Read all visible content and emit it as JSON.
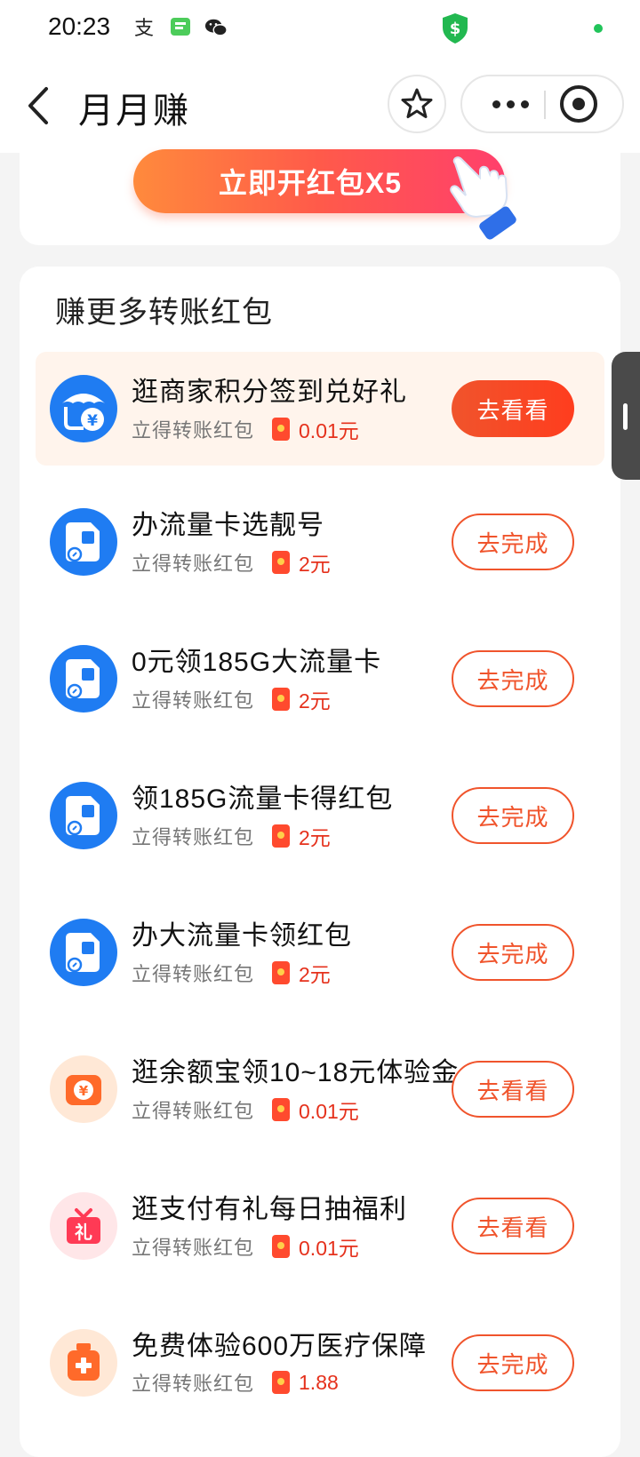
{
  "status_bar": {
    "time": "20:23",
    "icons": [
      "alipay-icon",
      "message-icon",
      "wechat-icon",
      "shield-dollar-icon",
      "online-dot-icon"
    ]
  },
  "nav": {
    "title": "月月赚",
    "icons": [
      "back-arrow-icon",
      "star-icon",
      "more-icon",
      "target-icon"
    ]
  },
  "top_card": {
    "open_button_label": "立即开红包X5"
  },
  "section": {
    "title": "赚更多转账红包",
    "tasks": [
      {
        "title": "逛商家积分签到兑好礼",
        "sub": "立得转账红包",
        "reward": "0.01元",
        "button": "去看看",
        "icon": "merchant-shop-icon",
        "highlight": true
      },
      {
        "title": "办流量卡选靓号",
        "sub": "立得转账红包",
        "reward": "2元",
        "button": "去完成",
        "icon": "sim-card-icon"
      },
      {
        "title": "0元领185G大流量卡",
        "sub": "立得转账红包",
        "reward": "2元",
        "button": "去完成",
        "icon": "sim-card-icon"
      },
      {
        "title": "领185G流量卡得红包",
        "sub": "立得转账红包",
        "reward": "2元",
        "button": "去完成",
        "icon": "sim-card-icon"
      },
      {
        "title": "办大流量卡领红包",
        "sub": "立得转账红包",
        "reward": "2元",
        "button": "去完成",
        "icon": "sim-card-icon"
      },
      {
        "title": "逛余额宝领10~18元体验金",
        "sub": "立得转账红包",
        "reward": "0.01元",
        "button": "去看看",
        "icon": "yuebao-icon"
      },
      {
        "title": "逛支付有礼每日抽福利",
        "sub": "立得转账红包",
        "reward": "0.01元",
        "button": "去看看",
        "icon": "gift-box-icon"
      },
      {
        "title": "免费体验600万医疗保障",
        "sub": "立得转账红包",
        "reward": "1.88",
        "button": "去完成",
        "icon": "medical-kit-icon"
      }
    ]
  },
  "colors": {
    "accent": "#f0542c",
    "reward_red": "#e5311c",
    "blue_icon": "#1f7cf2",
    "highlight_bg": "#fff4ec"
  }
}
